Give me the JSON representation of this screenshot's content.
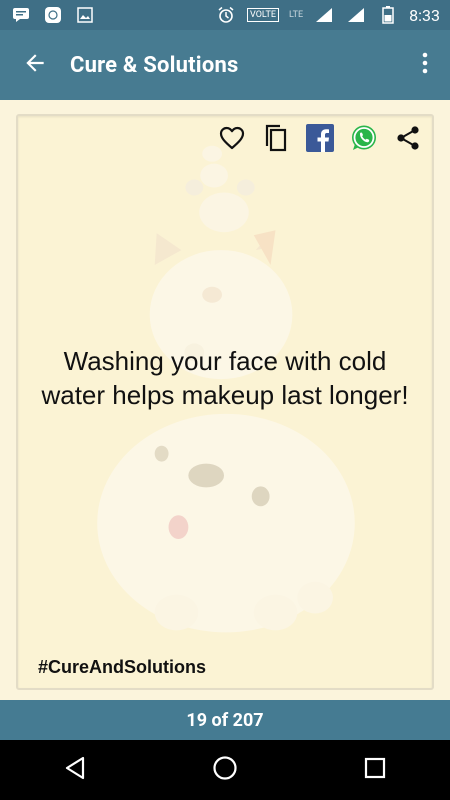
{
  "status_bar": {
    "time": "8:33",
    "volte": "VOLTE",
    "lte": "LTE",
    "icons": [
      "message-icon",
      "app-icon",
      "image-icon",
      "alarm-icon",
      "signal-icon",
      "signal-icon",
      "battery-icon"
    ]
  },
  "toolbar": {
    "title": "Cure & Solutions",
    "back_icon": "back-arrow-icon",
    "menu_icon": "more-vert-icon"
  },
  "card": {
    "quote": "Washing your face with cold water helps makeup last longer!",
    "hashtag": "#CureAndSolutions",
    "actions": [
      "heart-icon",
      "copy-icon",
      "facebook-icon",
      "whatsapp-icon",
      "share-icon"
    ]
  },
  "footer": {
    "pager": "19 of 207"
  },
  "colors": {
    "toolbar": "#477b91",
    "status_bar": "#3f6f86",
    "card_bg": "#fbf3d4",
    "facebook": "#3b5998",
    "whatsapp": "#2ab54a"
  }
}
